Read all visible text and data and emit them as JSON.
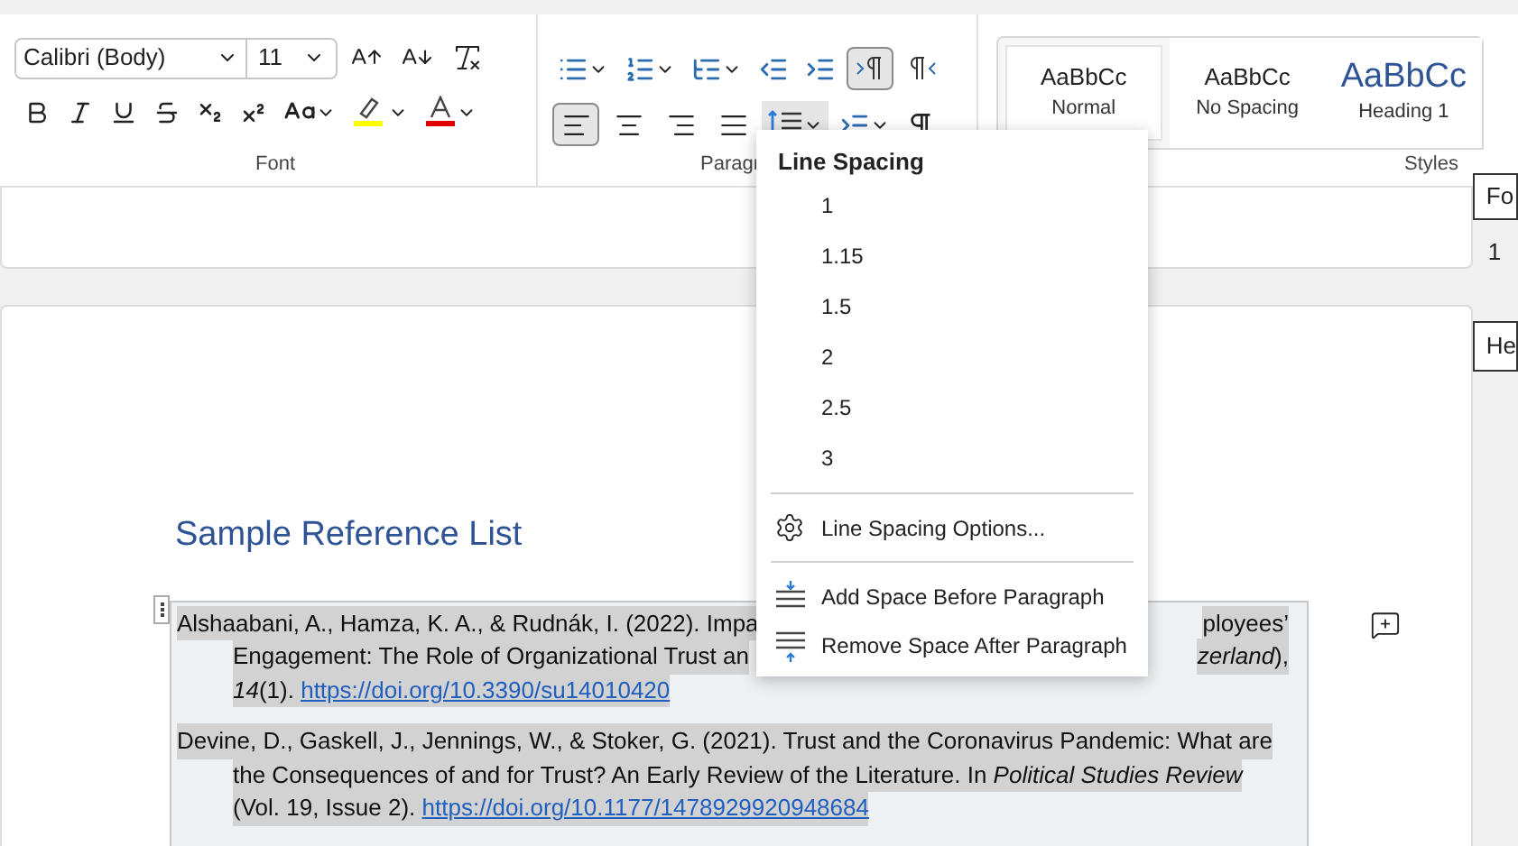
{
  "font_group": {
    "font": "Calibri (Body)",
    "size": "11",
    "label": "Font"
  },
  "paragraph_group": {
    "label": "Paragr",
    "direction_buttons": [
      {
        "selected": true
      },
      {
        "selected": false
      }
    ],
    "align_buttons": [
      {
        "selected": true
      },
      {
        "selected": false
      },
      {
        "selected": false
      },
      {
        "selected": false
      }
    ],
    "line_spacing_open": true
  },
  "styles_group": {
    "label": "Styles",
    "items": [
      {
        "kind": "normal",
        "sample": "AaBbCc",
        "name": "Normal",
        "selected": true
      },
      {
        "kind": "normal",
        "sample": "AaBbCc",
        "name": "No Spacing",
        "selected": false
      },
      {
        "kind": "heading",
        "sample": "AaBbCc",
        "name": "Heading 1",
        "selected": false
      }
    ]
  },
  "side_panel": [
    "Fo",
    "1",
    "He"
  ],
  "document": {
    "heading": "Sample Reference List",
    "references": [
      {
        "lines": [
          {
            "text": "Alshaabani, A., Hamza, K. A., & Rudnák, I. (2022). Impa",
            "right": "ployees’"
          },
          {
            "text": "Engagement: The Role of Organizational Trust an",
            "right": "*zerland*),"
          },
          {
            "text": "*14*(1). ",
            "link": "https://doi.org/10.3390/su14010420"
          }
        ]
      },
      {
        "lines": [
          {
            "text": "Devine, D., Gaskell, J., Jennings, W., & Stoker, G. (2021). Trust and the Coronavirus Pandemic: What are"
          },
          {
            "text": "the Consequences of and for Trust? An Early Review of the Literature. In *Political Studies Review*"
          },
          {
            "text": "(Vol. 19, Issue 2). ",
            "link": "https://doi.org/10.1177/1478929920948684"
          }
        ]
      }
    ]
  },
  "line_spacing_menu": {
    "title": "Line Spacing",
    "items": [
      {
        "kind": "value",
        "label": "1"
      },
      {
        "kind": "value",
        "label": "1.15"
      },
      {
        "kind": "value",
        "label": "1.5"
      },
      {
        "kind": "value",
        "label": "2"
      },
      {
        "kind": "value",
        "label": "2.5"
      },
      {
        "kind": "value",
        "label": "3"
      },
      {
        "kind": "dialog",
        "label": "Line Spacing Options..."
      },
      {
        "kind": "space_before",
        "label": "Add Space Before Paragraph"
      },
      {
        "kind": "space_after",
        "label": "Remove Space After Paragraph"
      }
    ]
  }
}
